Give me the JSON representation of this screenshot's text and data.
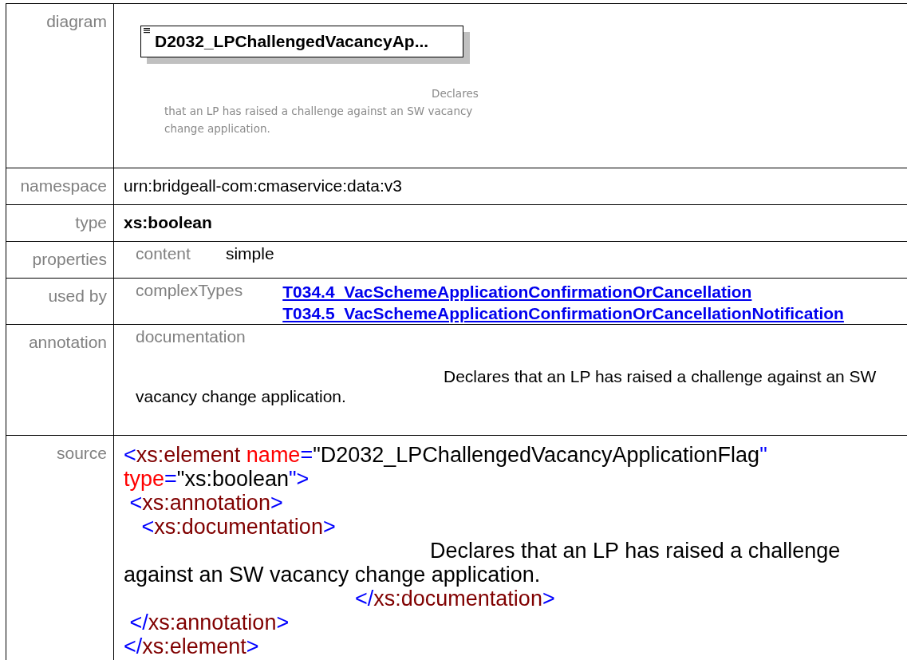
{
  "rows": [
    {
      "label": "diagram",
      "kind": "diagram",
      "diagram": {
        "title": "D2032_LPChallengedVacancyAp...",
        "doc": "Declares that an LP has raised a challenge against an SW vacancy change application."
      }
    },
    {
      "label": "namespace",
      "kind": "plain",
      "value": "urn:bridgeall-com:cmaservice:data:v3"
    },
    {
      "label": "type",
      "kind": "bold",
      "value": "xs:boolean"
    },
    {
      "label": "properties",
      "kind": "pairs",
      "pairs": [
        {
          "key": "content",
          "values": [
            "simple"
          ],
          "links": false
        }
      ]
    },
    {
      "label": "used by",
      "kind": "pairs",
      "pairs": [
        {
          "key": "complexTypes",
          "values": [
            "T034.4_VacSchemeApplicationConfirmationOrCancellation",
            "T034.5_VacSchemeApplicationConfirmationOrCancellationNotification"
          ],
          "links": true
        }
      ]
    },
    {
      "label": "annotation",
      "kind": "annotation",
      "key": "documentation",
      "doc": "Declares that an LP has raised a challenge against an SW vacancy change application."
    },
    {
      "label": "source",
      "kind": "source",
      "lines": [
        {
          "kind": "code",
          "tokens": [
            {
              "kind": "punct",
              "text": "<"
            },
            {
              "kind": "tag",
              "text": "xs:element "
            },
            {
              "kind": "attr",
              "text": "name"
            },
            {
              "kind": "punct",
              "text": "="
            },
            {
              "kind": "value",
              "text": "\"D2032_LPChallengedVacancyApplicationFlag"
            },
            {
              "kind": "punct",
              "text": "\""
            }
          ]
        },
        {
          "kind": "code",
          "tokens": [
            {
              "kind": "attr",
              "text": "type"
            },
            {
              "kind": "punct",
              "text": "="
            },
            {
              "kind": "value",
              "text": "\"xs:boolean"
            },
            {
              "kind": "punct",
              "text": "\">"
            }
          ]
        },
        {
          "kind": "code",
          "tokens": [
            {
              "kind": "punct",
              "text": " <"
            },
            {
              "kind": "tag",
              "text": "xs:annotation"
            },
            {
              "kind": "punct",
              "text": ">"
            }
          ]
        },
        {
          "kind": "code",
          "tokens": [
            {
              "kind": "punct",
              "text": "   <"
            },
            {
              "kind": "tag",
              "text": "xs:documentation"
            },
            {
              "kind": "punct",
              "text": ">"
            }
          ]
        },
        {
          "kind": "doc",
          "tokens": [
            {
              "kind": "value",
              "text": "Declares that an LP has raised a challenge against an SW vacancy change application."
            }
          ]
        },
        {
          "kind": "trail",
          "tokens": [
            {
              "kind": "punct",
              "text": "</"
            },
            {
              "kind": "tag",
              "text": "xs:documentation"
            },
            {
              "kind": "punct",
              "text": ">"
            }
          ]
        },
        {
          "kind": "code",
          "tokens": [
            {
              "kind": "punct",
              "text": " </"
            },
            {
              "kind": "tag",
              "text": "xs:annotation"
            },
            {
              "kind": "punct",
              "text": ">"
            }
          ]
        },
        {
          "kind": "code",
          "tokens": [
            {
              "kind": "punct",
              "text": "</"
            },
            {
              "kind": "tag",
              "text": "xs:element"
            },
            {
              "kind": "punct",
              "text": ">"
            }
          ]
        }
      ]
    }
  ]
}
